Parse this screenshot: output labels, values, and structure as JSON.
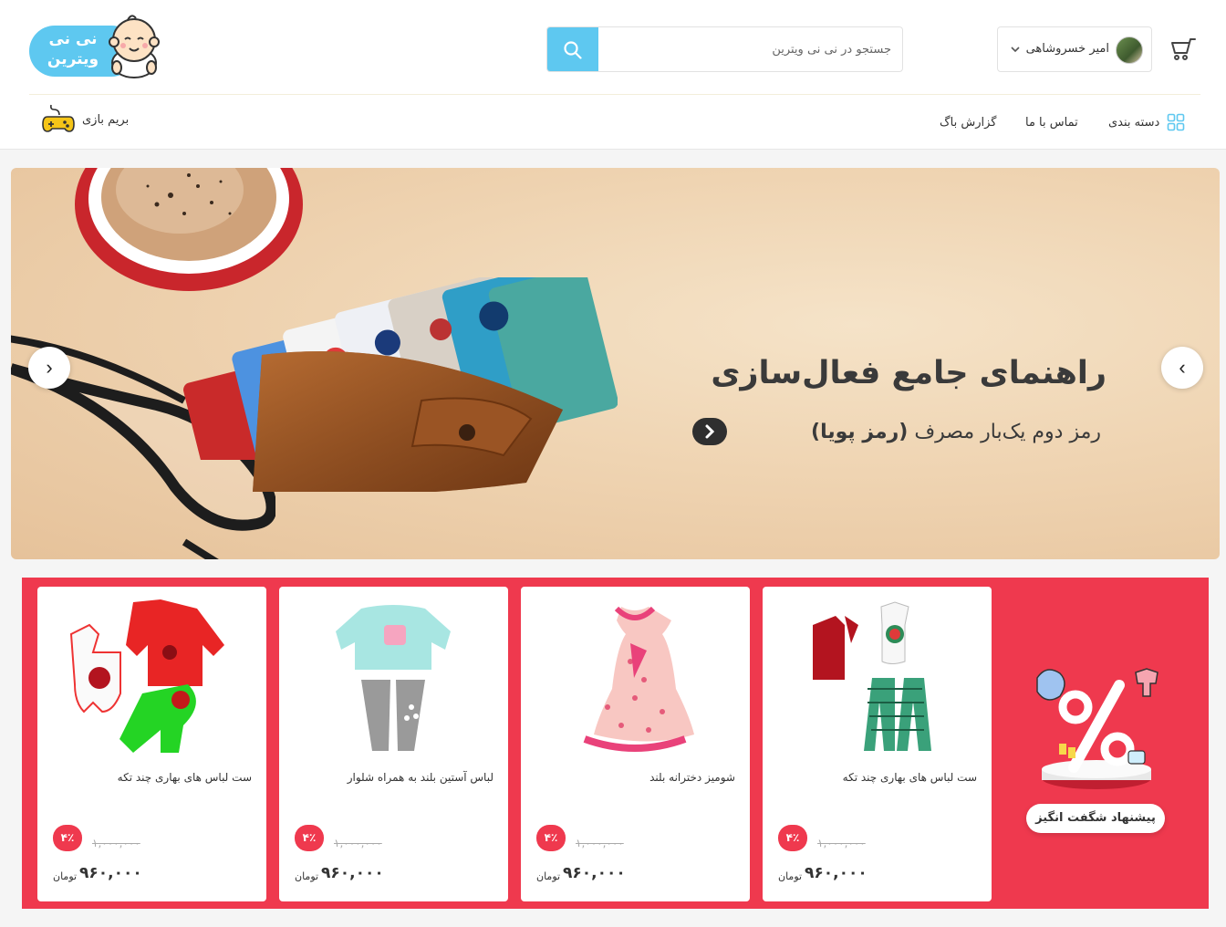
{
  "header": {
    "logo_text_line1": "نی نی",
    "logo_text_line2": "ویترین",
    "user_name": "امیر خسروشاهی",
    "search_placeholder": "جستجو در نی نی ویترین"
  },
  "nav": {
    "categories": "دسته بندی",
    "contact": "تماس با ما",
    "bug_report": "گزارش باگ",
    "play": "بریم بازی"
  },
  "slider": {
    "title": "راهنمای جامع فعال‌سازی",
    "subtitle_prefix": "رمز دوم یک‌بار مصرف",
    "subtitle_bold": "(رمز پویا)",
    "prev_arrow": "›",
    "next_arrow": "‹"
  },
  "offers": {
    "badge": "پیشنهاد شگفت انگیز",
    "currency": "تومان",
    "products": [
      {
        "name": "ست لباس های بهاری چند تکه",
        "discount": "۴٪",
        "old_price": "۱,۰۰۰,۰۰۰",
        "price": "۹۶۰,۰۰۰"
      },
      {
        "name": "شومیز دخترانه بلند",
        "discount": "۴٪",
        "old_price": "۱,۰۰۰,۰۰۰",
        "price": "۹۶۰,۰۰۰"
      },
      {
        "name": "لباس آستین بلند به همراه شلوار",
        "discount": "۴٪",
        "old_price": "۱,۰۰۰,۰۰۰",
        "price": "۹۶۰,۰۰۰"
      },
      {
        "name": "ست لباس های بهاری چند تکه",
        "discount": "۴٪",
        "old_price": "۱,۰۰۰,۰۰۰",
        "price": "۹۶۰,۰۰۰"
      }
    ]
  },
  "colors": {
    "accent_blue": "#5ec8f0",
    "offer_red": "#ef394e"
  }
}
